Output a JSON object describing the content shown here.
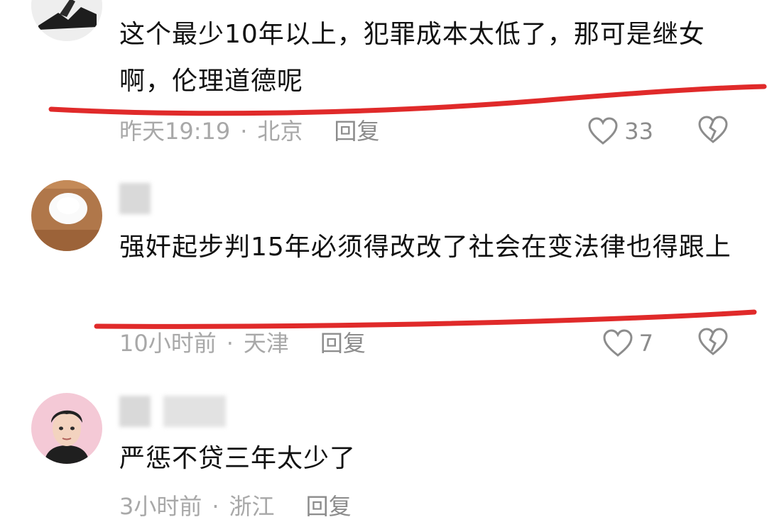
{
  "comments": [
    {
      "text": "这个最少10年以上，犯罪成本太低了，那可是继女啊，伦理道德呢",
      "time": "昨天19:19",
      "location": "北京",
      "reply": "回复",
      "likes": "33",
      "avatar_icon": "silhouette-avatar"
    },
    {
      "text": "强奸起步判15年必须得改改了社会在变法律也得跟上",
      "time": "10小时前",
      "location": "天津",
      "reply": "回复",
      "likes": "7",
      "avatar_icon": "wood-cup-avatar"
    },
    {
      "text": "严惩不贷三年太少了",
      "time": "3小时前",
      "location": "浙江",
      "reply": "回复",
      "likes": "",
      "avatar_icon": "cartoon-man-avatar"
    }
  ],
  "separator": "·",
  "colors": {
    "annotation_red": "#e02a2a",
    "meta_gray": "#a8a8a8",
    "text": "#111111"
  }
}
